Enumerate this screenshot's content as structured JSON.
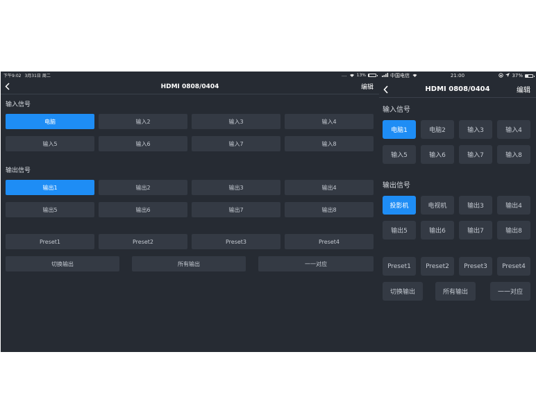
{
  "tablet": {
    "status": {
      "time": "下午9:02",
      "date": "3月31日 周二",
      "dots": "....",
      "battery": "13%",
      "battery_level": 0.13
    },
    "title": "HDMI 0808/0404",
    "edit": "编辑",
    "input_title": "输入信号",
    "inputs": [
      "电脑",
      "输入2",
      "输入3",
      "输入4",
      "输入5",
      "输入6",
      "输入7",
      "输入8"
    ],
    "output_title": "输出信号",
    "outputs": [
      "输出1",
      "输出2",
      "输出3",
      "输出4",
      "输出5",
      "输出6",
      "输出7",
      "输出8"
    ],
    "presets": [
      "Preset1",
      "Preset2",
      "Preset3",
      "Preset4"
    ],
    "actions": [
      "切换输出",
      "所有输出",
      "一一对应"
    ]
  },
  "phone": {
    "status": {
      "carrier": "中国电信",
      "time": "21:00",
      "battery": "37%",
      "battery_level": 0.37
    },
    "title": "HDMI 0808/0404",
    "edit": "编辑",
    "input_title": "输入信号",
    "inputs": [
      "电脑1",
      "电脑2",
      "输入3",
      "输入4",
      "输入5",
      "输入6",
      "输入7",
      "输入8"
    ],
    "output_title": "输出信号",
    "outputs": [
      "投影机",
      "电视机",
      "输出3",
      "输出4",
      "输出5",
      "输出6",
      "输出7",
      "输出8"
    ],
    "presets": [
      "Preset1",
      "Preset2",
      "Preset3",
      "Preset4"
    ],
    "actions": [
      "切换输出",
      "所有输出",
      "一一对应"
    ]
  },
  "colors": {
    "background": "#262b33",
    "button": "#343a44",
    "active": "#1e8df5"
  },
  "selection": {
    "active_input": 0,
    "active_output": 0
  }
}
